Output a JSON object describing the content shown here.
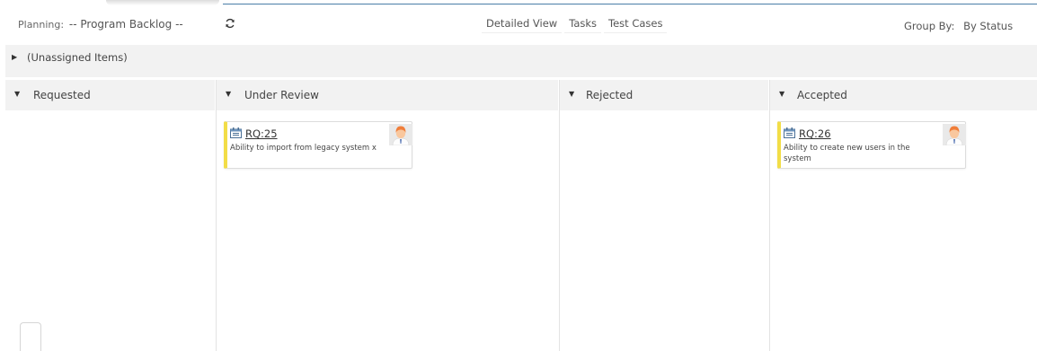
{
  "toolbar": {
    "planning_label": "Planning:",
    "planning_value": "-- Program Backlog --",
    "refresh_icon": "refresh-icon",
    "views": [
      "Detailed View",
      "Tasks",
      "Test Cases"
    ],
    "groupby_label": "Group By:",
    "groupby_value": "By Status"
  },
  "unassigned": {
    "label": "(Unassigned Items)"
  },
  "columns": [
    {
      "title": "Requested"
    },
    {
      "title": "Under Review"
    },
    {
      "title": "Rejected"
    },
    {
      "title": "Accepted"
    }
  ],
  "cards": [
    {
      "id": "RQ:25",
      "description": "Ability to import from legacy system x"
    },
    {
      "id": "RQ:26",
      "description_line1": "Ability to create new users in the",
      "description_line2": "system"
    }
  ],
  "colors": {
    "card_accent": "#f2dd47",
    "header_bg": "#f2f2f2",
    "avatar_hair": "#f07e3a",
    "avatar_skin": "#f9c79e"
  }
}
